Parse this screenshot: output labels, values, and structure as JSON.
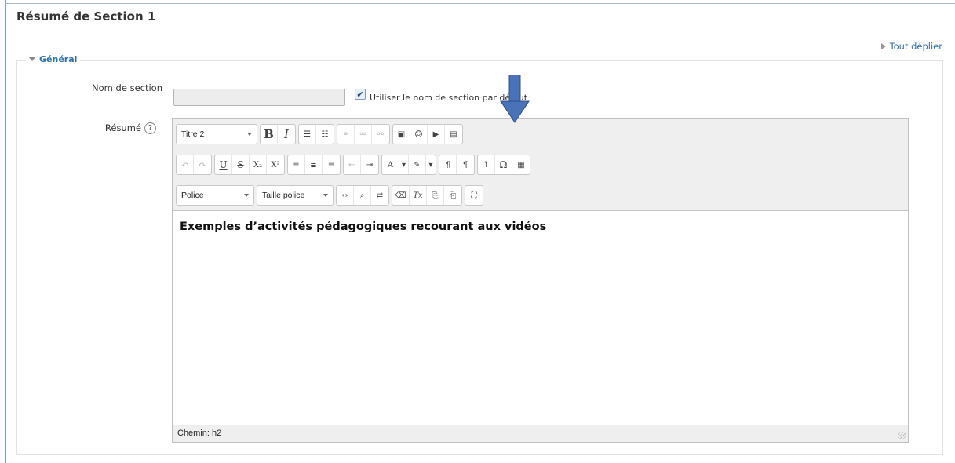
{
  "page": {
    "title": "Résumé de Section 1",
    "expand_all": "Tout déplier"
  },
  "fieldset": {
    "legend": "Général"
  },
  "form": {
    "section_name_label": "Nom de section",
    "section_name_value": "",
    "use_default_label": "Utiliser le nom de section par défaut",
    "use_default_checked": true,
    "summary_label": "Résumé"
  },
  "editor": {
    "format_select": "Titre 2",
    "font_select": "Police",
    "size_select": "Taille police",
    "content_heading": "Exemples d’activités pédagogiques recourant aux vidéos",
    "path": "Chemin: h2"
  },
  "colors": {
    "accent_link": "#2f6fab",
    "arrow": "#4a72b8"
  }
}
